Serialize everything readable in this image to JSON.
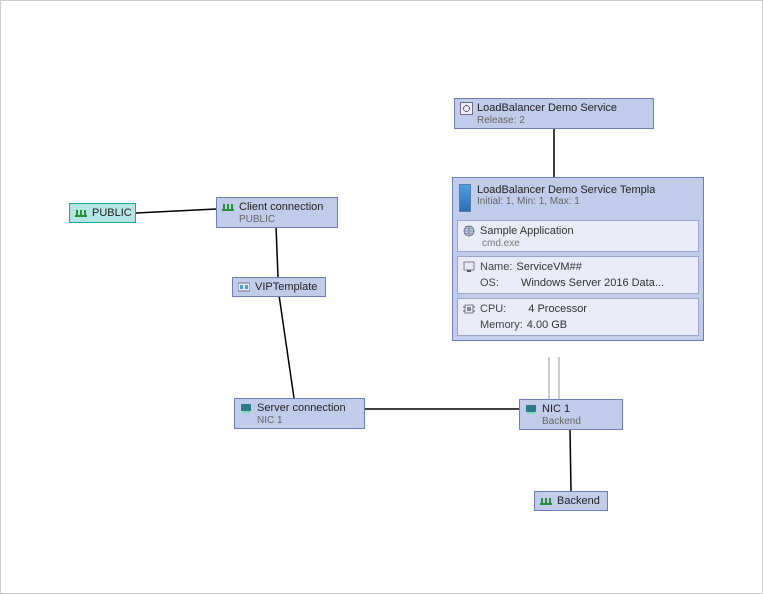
{
  "nodes": {
    "public": {
      "label": "PUBLIC"
    },
    "client_connection": {
      "label": "Client connection",
      "sub": "PUBLIC"
    },
    "vip_template": {
      "label": "VIPTemplate"
    },
    "server_connection": {
      "label": "Server connection",
      "sub": "NIC 1"
    },
    "lb_service": {
      "label": "LoadBalancer Demo Service",
      "sub": "Release: 2"
    },
    "nic1": {
      "label": "NIC 1",
      "sub": "Backend"
    },
    "backend": {
      "label": "Backend"
    }
  },
  "template": {
    "title": "LoadBalancer Demo Service Templa",
    "scale": "Initial: 1, Min: 1, Max: 1",
    "app": {
      "name": "Sample Application",
      "exe": "cmd.exe"
    },
    "vm": {
      "name_label": "Name:",
      "name_value": "ServiceVM##",
      "os_label": "OS:",
      "os_value": "Windows Server 2016 Data..."
    },
    "hw": {
      "cpu_label": "CPU:",
      "cpu_value": "4 Processor",
      "mem_label": "Memory:",
      "mem_value": "4.00 GB"
    }
  },
  "edges": [
    {
      "from": "public",
      "to": "client_connection"
    },
    {
      "from": "client_connection",
      "to": "vip_template"
    },
    {
      "from": "vip_template",
      "to": "server_connection"
    },
    {
      "from": "lb_service",
      "to": "service_template"
    },
    {
      "from": "service_template",
      "to": "nic1"
    },
    {
      "from": "server_connection",
      "to": "nic1"
    },
    {
      "from": "nic1",
      "to": "backend"
    }
  ],
  "colors": {
    "node_fill": "#c0ccea",
    "node_border": "#6b7eb7",
    "selected_fill": "#b3e6e3",
    "selected_border": "#1aa99e",
    "panel_fill": "#e9ecf6"
  }
}
